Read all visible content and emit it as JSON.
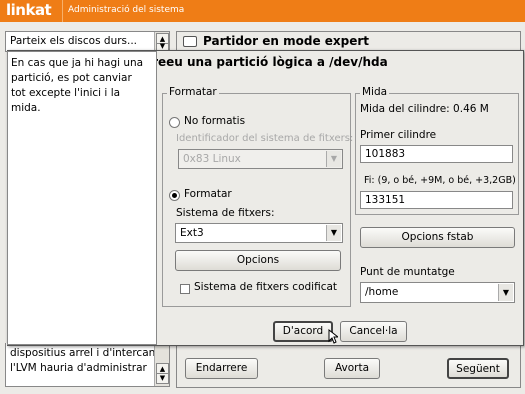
{
  "app": {
    "logo": "linkat",
    "title": "Administració del sistema"
  },
  "left_panel": {
    "dropdown": "Parteix els discos durs...",
    "help_text": "En cas que ja hi hagi una partició, es pot canviar tot excepte l'inici i la mida.",
    "bottom_text_1": "dispositius arrel i d'intercanvi,",
    "bottom_text_2": "l'LVM hauria d'administrar"
  },
  "main_panel": {
    "title": "Partidor en mode expert"
  },
  "wizard_buttons": {
    "back": "Endarrere",
    "abort": "Avorta",
    "next": "Següent"
  },
  "dialog": {
    "title": "Creeu una partició lògica a /dev/hda",
    "format": {
      "legend": "Formatar",
      "no_format_label": "No formatis",
      "fs_id_label": "Identificador del sistema de fitxers:",
      "fs_id_value": "0x83 Linux",
      "format_label": "Formatar",
      "fs_label": "Sistema de fitxers:",
      "fs_value": "Ext3",
      "options_button": "Opcions",
      "encrypted_label": "Sistema de fitxers codificat"
    },
    "size": {
      "legend": "Mida",
      "cylinder_size": "Mida del cilindre: 0.46 M",
      "first_cyl_label": "Primer cilindre",
      "first_cyl_value": "101883",
      "end_label": "Fi:  (9, o bé, +9M, o bé, +3,2GB)",
      "end_value": "133151"
    },
    "fstab_button": "Opcions fstab",
    "mount_label": "Punt de muntatge",
    "mount_value": "/home",
    "ok_button": "D'acord",
    "cancel_button": "Cancel·la"
  },
  "colors": {
    "accent": "#ef7d16"
  }
}
